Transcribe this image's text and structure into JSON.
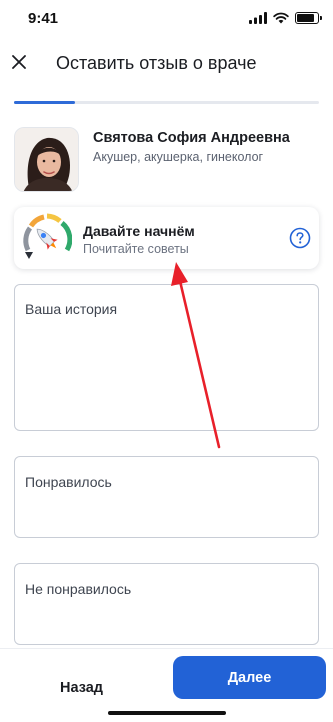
{
  "status_bar": {
    "time": "9:41",
    "battery_level": 0.85
  },
  "header": {
    "title": "Оставить отзыв о враче",
    "close_icon": "close-icon"
  },
  "progress": {
    "value": 0.2,
    "color": "#2e6bd8"
  },
  "doctor": {
    "name": "Святова София Андреевна",
    "specialties": "Акушер, акушерка, гинеколог",
    "avatar_icon": "doctor-photo"
  },
  "tips_card": {
    "title": "Давайте начнём",
    "subtitle": "Почитайте советы",
    "gauge_icon": "rocket-gauge-icon",
    "help_icon": "question-circle-icon"
  },
  "form": {
    "story_placeholder": "Ваша история",
    "liked_placeholder": "Понравилось",
    "disliked_placeholder": "Не понравилось"
  },
  "footer": {
    "back_label": "Назад",
    "next_label": "Далее"
  },
  "colors": {
    "accent": "#2262d6",
    "annotation": "#e8202a"
  }
}
